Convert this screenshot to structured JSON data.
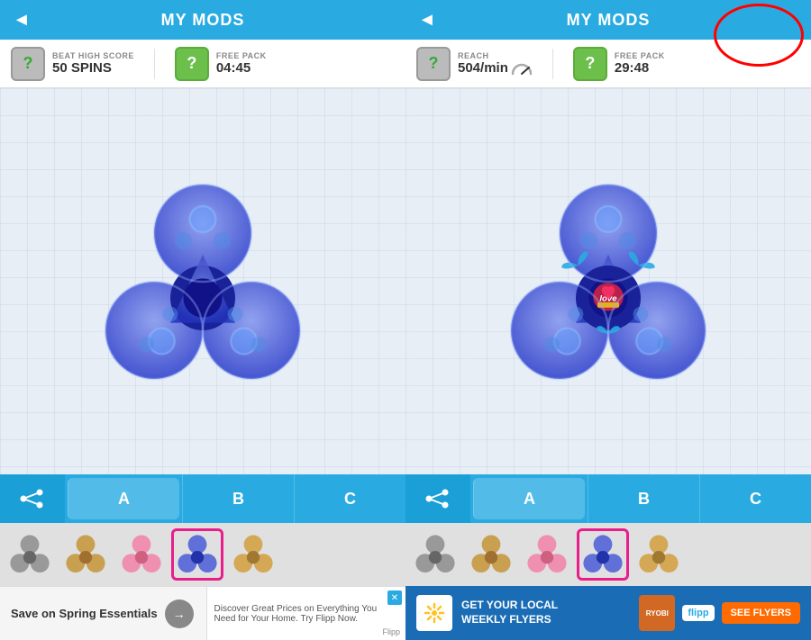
{
  "left_panel": {
    "header": {
      "title": "MY MODS",
      "back_label": "◄"
    },
    "stats": {
      "stat1": {
        "label": "BEAT HIGH SCORE",
        "value": "50 SPINS"
      },
      "stat2": {
        "label": "FREE PACK",
        "value": "04:45"
      }
    },
    "toolbar": {
      "tab_a": "A",
      "tab_b": "B",
      "tab_c": "C"
    },
    "swatches": [
      {
        "color": "#888",
        "selected": false,
        "id": "gray"
      },
      {
        "color": "#c8a050",
        "selected": false,
        "id": "gold"
      },
      {
        "color": "#f090b0",
        "selected": false,
        "id": "pink"
      },
      {
        "color": "#6070d8",
        "selected": true,
        "id": "blue"
      },
      {
        "color": "#c8a050",
        "selected": false,
        "id": "gold2"
      }
    ],
    "ad": {
      "left_text": "Save on Spring Essentials",
      "right_text": "Discover Great Prices on Everything You Need for Your Home. Try Flipp Now.",
      "brand": "Flipp"
    }
  },
  "right_panel": {
    "header": {
      "title": "MY MODS",
      "back_label": "◄"
    },
    "stats": {
      "stat1": {
        "label": "REACH",
        "value": "504/min"
      },
      "stat2": {
        "label": "FREE PACK",
        "value": "29:48"
      }
    },
    "toolbar": {
      "tab_a": "A",
      "tab_b": "B",
      "tab_c": "C"
    },
    "swatches": [
      {
        "color": "#888",
        "selected": false,
        "id": "gray"
      },
      {
        "color": "#c8a050",
        "selected": false,
        "id": "gold"
      },
      {
        "color": "#f090b0",
        "selected": false,
        "id": "pink"
      },
      {
        "color": "#6070d8",
        "selected": true,
        "id": "blue"
      },
      {
        "color": "#c8a050",
        "selected": false,
        "id": "gold2"
      }
    ],
    "ad": {
      "text1": "GET YOUR LOCAL",
      "text2": "WEEKLY FLYERS",
      "brand": "flipp",
      "cta": "SEE FLYERS"
    }
  }
}
